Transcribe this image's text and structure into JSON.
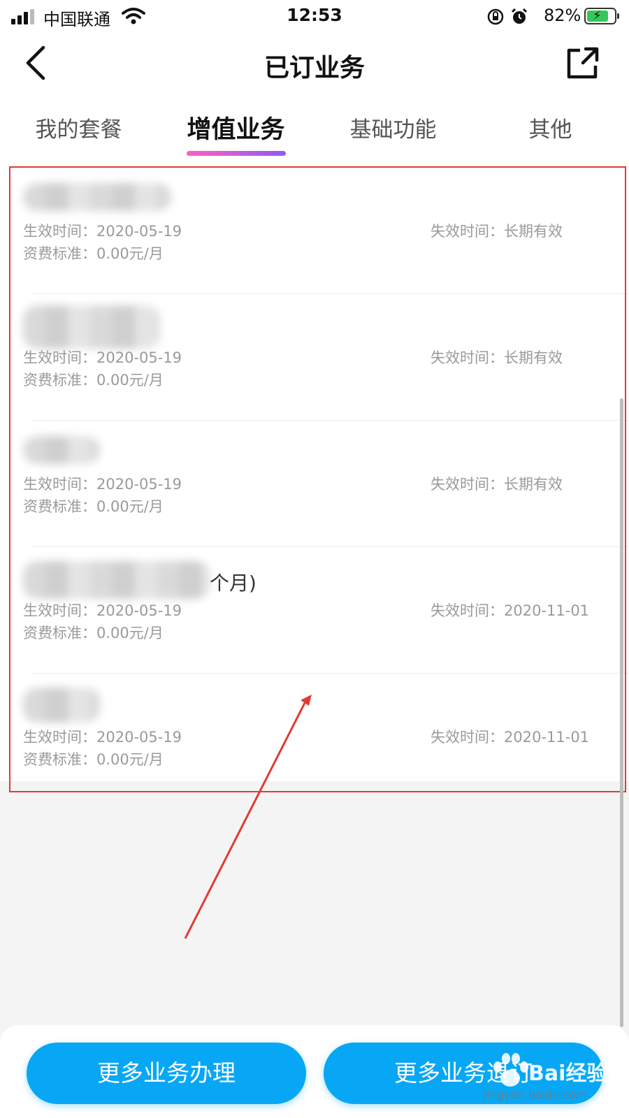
{
  "status_bar": {
    "carrier": "中国联通",
    "time": "12:53",
    "battery_percent": "82%"
  },
  "nav": {
    "title": "已订业务"
  },
  "tabs": [
    {
      "label": "我的套餐",
      "active": false
    },
    {
      "label": "增值业务",
      "active": true
    },
    {
      "label": "基础功能",
      "active": false
    },
    {
      "label": "其他",
      "active": false
    }
  ],
  "items": [
    {
      "name_suffix": "",
      "effective": "生效时间：2020-05-19",
      "fee": "资费标准：0.00元/月",
      "expiry": "失效时间：长期有效"
    },
    {
      "name_suffix": "",
      "effective": "生效时间：2020-05-19",
      "fee": "资费标准：0.00元/月",
      "expiry": "失效时间：长期有效"
    },
    {
      "name_suffix": "",
      "effective": "生效时间：2020-05-19",
      "fee": "资费标准：0.00元/月",
      "expiry": "失效时间：长期有效"
    },
    {
      "name_suffix": "个月)",
      "effective": "生效时间：2020-05-19",
      "fee": "资费标准：0.00元/月",
      "expiry": "失效时间：2020-11-01"
    },
    {
      "name_suffix": "",
      "effective": "生效时间：2020-05-19",
      "fee": "资费标准：0.00元/月",
      "expiry": "失效时间：2020-11-01"
    }
  ],
  "buttons": {
    "more_business": "更多业务办理",
    "more_unsubscribe": "更多业务退订"
  },
  "watermark": {
    "text": "Bai经验",
    "url": "jingyan.baidu.com"
  },
  "colors": {
    "primary_button": "#07a7f5",
    "highlight": "#e23a33",
    "tab_underline_start": "#ff5fc3",
    "tab_underline_end": "#8f5cf0"
  }
}
